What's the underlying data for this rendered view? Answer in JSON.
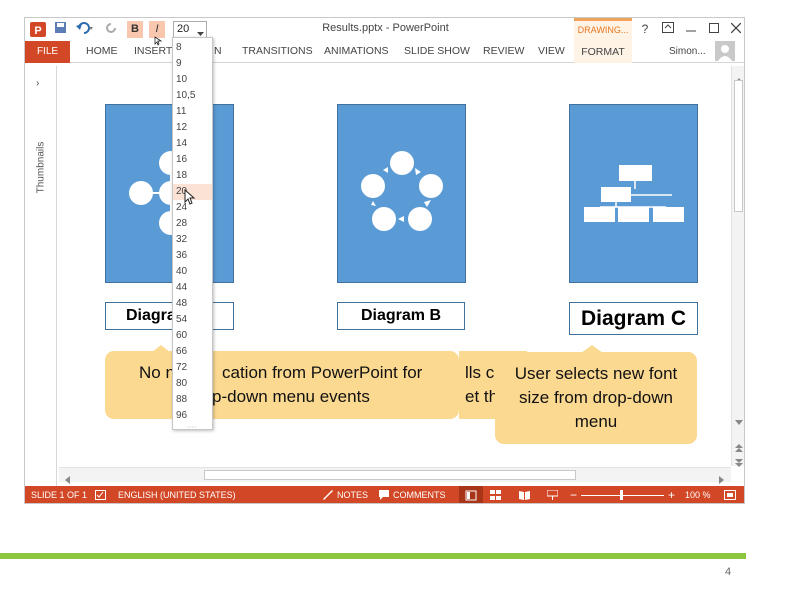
{
  "window": {
    "title": "Results.pptx - PowerPoint",
    "drawing_tools_label": "DRAWING...",
    "user_name": "Simon...",
    "font_size_value": "20"
  },
  "ribbon": {
    "file_label": "FILE",
    "tabs": [
      "HOME",
      "INSERT",
      "N",
      "TRANSITIONS",
      "ANIMATIONS",
      "SLIDE SHOW",
      "REVIEW",
      "VIEW"
    ],
    "format_label": "FORMAT"
  },
  "thumbnails_label": "Thumbnails",
  "font_size_options": [
    "8",
    "9",
    "10",
    "10,5",
    "11",
    "12",
    "14",
    "16",
    "18",
    "20",
    "24",
    "28",
    "32",
    "36",
    "40",
    "44",
    "48",
    "54",
    "60",
    "66",
    "72",
    "80",
    "88",
    "96"
  ],
  "font_size_selected": "20",
  "slide": {
    "diagrams": [
      {
        "label": "Diagram A",
        "visible_label": "Diagra"
      },
      {
        "label": "Diagram B",
        "visible_label": "Diagram B"
      },
      {
        "label": "Diagram C",
        "visible_label": "Diagram C"
      }
    ],
    "callout_1_line1_a": "No n",
    "callout_1_line1_b": "cation from PowerPoint for",
    "callout_1_line2_b": "p-down menu events",
    "callout_2_line1": "lls c",
    "callout_2_line2": "et th",
    "callout_3": "User selects new font size from drop-down menu"
  },
  "status": {
    "slide_info": "SLIDE 1 OF 1",
    "language": "ENGLISH (UNITED STATES)",
    "notes": "NOTES",
    "comments": "COMMENTS",
    "zoom": "100 %"
  },
  "page_number": "4",
  "colors": {
    "accent": "#d24726",
    "diagram_fill": "#5b9bd5",
    "callout_fill": "#fbd991",
    "green_line": "#8dc63f"
  }
}
